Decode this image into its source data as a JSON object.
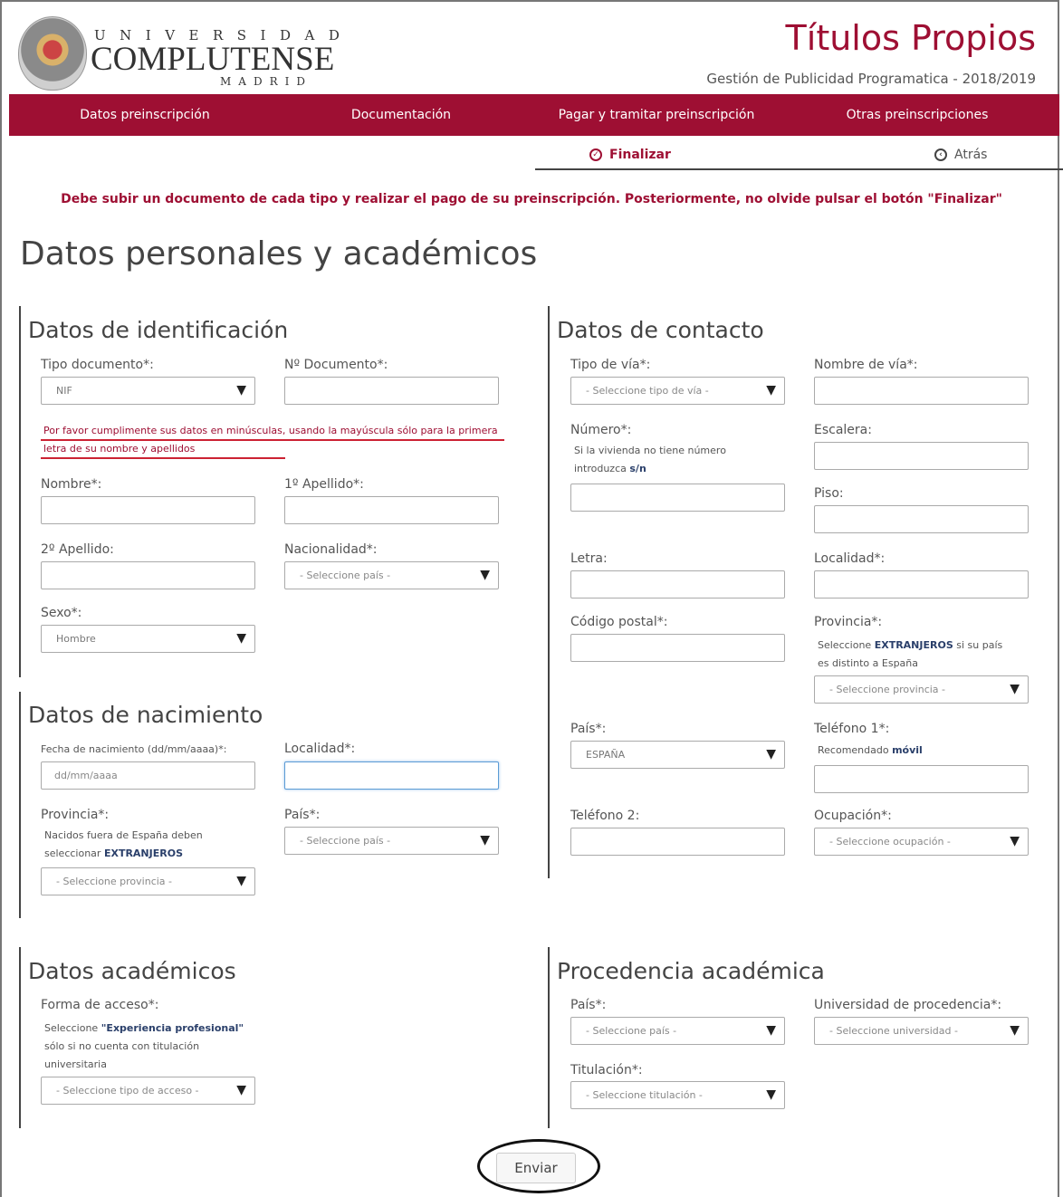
{
  "header": {
    "logo_top": "UNIVERSIDAD",
    "logo_main": "COMPLUTENSE",
    "logo_bottom": "MADRID",
    "title": "Títulos Propios",
    "subtitle": "Gestión de Publicidad Programatica - 2018/2019"
  },
  "nav": [
    {
      "label": "Datos preinscripción"
    },
    {
      "label": "Documentación"
    },
    {
      "label": "Pagar y tramitar preinscripción"
    },
    {
      "label": "Otras preinscripciones"
    }
  ],
  "subnav": {
    "finalizar": "Finalizar",
    "atras": "Atrás"
  },
  "notice": "Debe subir un documento de cada tipo y realizar el pago de su preinscripción. Posteriormente, no olvide pulsar el botón \"Finalizar\"",
  "page_title": "Datos personales y académicos",
  "identificacion": {
    "title": "Datos de identificación",
    "tipo_documento_label": "Tipo documento*:",
    "tipo_documento_value": "NIF",
    "num_documento_label": "Nº Documento*:",
    "warning": "Por favor cumplimente sus datos en minúsculas, usando la mayúscula sólo para la primera letra de su nombre y apellidos",
    "nombre_label": "Nombre*:",
    "apellido1_label": "1º Apellido*:",
    "apellido2_label": "2º Apellido:",
    "nacionalidad_label": "Nacionalidad*:",
    "nacionalidad_placeholder": "- Seleccione país -",
    "sexo_label": "Sexo*:",
    "sexo_value": "Hombre"
  },
  "nacimiento": {
    "title": "Datos de nacimiento",
    "fecha_label": "Fecha de nacimiento (dd/mm/aaaa)*:",
    "fecha_placeholder": "dd/mm/aaaa",
    "localidad_label": "Localidad*:",
    "provincia_label": "Provincia*:",
    "provincia_hint_1": "Nacidos fuera de España deben",
    "provincia_hint_2": "seleccionar",
    "provincia_hint_bold": "EXTRANJEROS",
    "provincia_placeholder": "- Seleccione provincia -",
    "pais_label": "País*:",
    "pais_placeholder": "- Seleccione país -"
  },
  "academicos": {
    "title": "Datos académicos",
    "forma_acceso_label": "Forma de acceso*:",
    "hint_prefix": "Seleccione",
    "hint_bold": "\"Experiencia profesional\"",
    "hint_line2": "sólo si no cuenta con titulación",
    "hint_line3": "universitaria",
    "forma_acceso_placeholder": "- Seleccione tipo de acceso -"
  },
  "contacto": {
    "title": "Datos de contacto",
    "tipo_via_label": "Tipo de vía*:",
    "tipo_via_placeholder": "- Seleccione tipo de vía -",
    "nombre_via_label": "Nombre de vía*:",
    "numero_label": "Número*:",
    "numero_hint_1": "Si la vivienda no tiene número",
    "numero_hint_2": "introduzca",
    "numero_hint_bold": "s/n",
    "escalera_label": "Escalera:",
    "piso_label": "Piso:",
    "letra_label": "Letra:",
    "localidad_label": "Localidad*:",
    "cp_label": "Código postal*:",
    "provincia_label": "Provincia*:",
    "provincia_hint_prefix": "Seleccione",
    "provincia_hint_bold": "EXTRANJEROS",
    "provincia_hint_suffix": "si su país",
    "provincia_hint_2": "es distinto a España",
    "provincia_placeholder": "- Seleccione provincia -",
    "pais_label": "País*:",
    "pais_value": "ESPAÑA",
    "telefono1_label": "Teléfono 1*:",
    "telefono1_hint_prefix": "Recomendado",
    "telefono1_hint_bold": "móvil",
    "telefono2_label": "Teléfono 2:",
    "ocupacion_label": "Ocupación*:",
    "ocupacion_placeholder": "- Seleccione ocupación -"
  },
  "procedencia": {
    "title": "Procedencia académica",
    "pais_label": "País*:",
    "pais_placeholder": "- Seleccione país -",
    "universidad_label": "Universidad de procedencia*:",
    "universidad_placeholder": "- Seleccione universidad -",
    "titulacion_label": "Titulación*:",
    "titulacion_placeholder": "- Seleccione titulación -"
  },
  "submit_label": "Enviar"
}
